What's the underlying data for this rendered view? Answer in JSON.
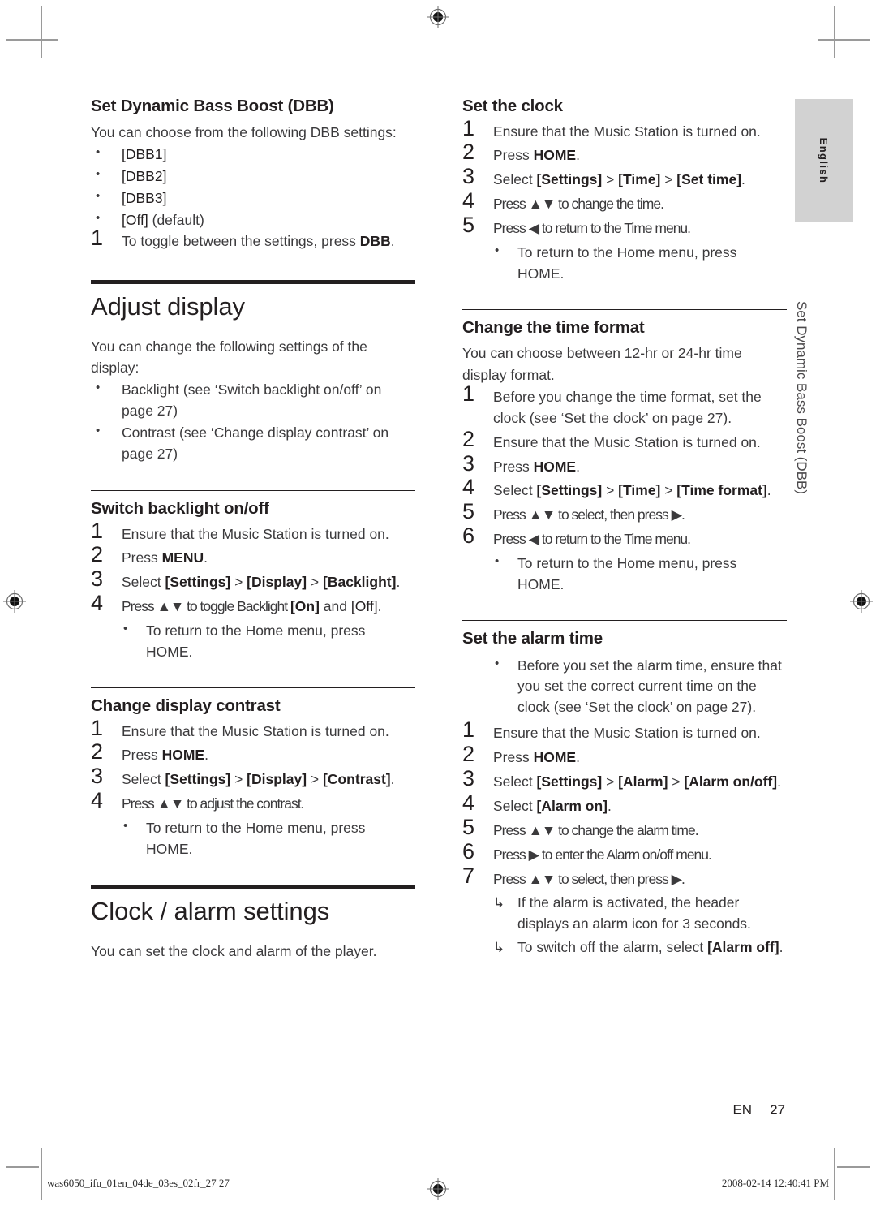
{
  "page": {
    "language_tab": "English",
    "running_head": "Set Dynamic Bass Boost (DBB)",
    "folio_lang": "EN",
    "folio_number": "27"
  },
  "print_footer": {
    "filename": "was6050_ifu_01en_04de_03es_02fr_27   27",
    "timestamp": "2008-02-14   12:40:41 PM"
  },
  "left_column": {
    "dbb": {
      "heading": "Set Dynamic Bass Boost (DBB)",
      "intro": "You can choose from the following DBB settings:",
      "options": [
        "[DBB1]",
        "[DBB2]",
        "[DBB3]"
      ],
      "option_default_key": "[Off]",
      "option_default_note": "(default)",
      "step_1_pre": "To toggle between the settings, press ",
      "step_1_key": "DBB",
      "step_1_post": "."
    },
    "adjust_display": {
      "chapter": "Adjust display",
      "intro": "You can change the following settings of the display:",
      "bullets": [
        "Backlight (see ‘Switch backlight on/off’ on page 27)",
        "Contrast (see ‘Change display contrast’ on page 27)"
      ]
    },
    "backlight": {
      "heading": "Switch backlight on/off",
      "step_1": "Ensure that the Music Station is turned on.",
      "step_2_pre": "Press ",
      "step_2_key": "MENU",
      "step_2_post": ".",
      "step_3_pre": "Select ",
      "step_3_k1": "[Settings]",
      "step_3_s1": " > ",
      "step_3_k2": "[Display]",
      "step_3_s2": " > ",
      "step_3_k3": "[Backlight]",
      "step_3_post": ".",
      "step_4_pre": "Press ▲▼ to toggle Backlight ",
      "step_4_k1": "[On]",
      "step_4_mid": " and ",
      "step_4_k2": "[Off]",
      "step_4_post": ".",
      "sub_bullet_line1": "To return to the Home menu, press",
      "sub_bullet_line2": "HOME."
    },
    "contrast": {
      "heading": "Change display contrast",
      "step_1": "Ensure that the Music Station is turned on.",
      "step_2_pre": "Press ",
      "step_2_key": "HOME",
      "step_2_post": ".",
      "step_3_pre": "Select ",
      "step_3_k1": "[Settings]",
      "step_3_s1": " > ",
      "step_3_k2": "[Display]",
      "step_3_s2": " > ",
      "step_3_k3": "[Contrast]",
      "step_3_post": ".",
      "step_4": "Press ▲▼ to adjust the contrast.",
      "sub_bullet_line1": "To return to the Home menu, press",
      "sub_bullet_line2": "HOME."
    },
    "clock_alarm": {
      "chapter": "Clock / alarm settings",
      "intro": "You can set the clock and alarm of the player."
    }
  },
  "right_column": {
    "set_clock": {
      "heading": "Set the clock",
      "step_1": "Ensure that the Music Station is turned on.",
      "step_2_pre": "Press ",
      "step_2_key": "HOME",
      "step_2_post": ".",
      "step_3_pre": "Select ",
      "step_3_k1": "[Settings]",
      "step_3_s1": " > ",
      "step_3_k2": "[Time]",
      "step_3_s2": " > ",
      "step_3_k3": "[Set time]",
      "step_3_post": ".",
      "step_4": "Press ▲▼ to change the time.",
      "step_5": "Press ◀ to return to the Time menu.",
      "sub_bullet_line1": "To return to the Home menu, press",
      "sub_bullet_line2": "HOME."
    },
    "time_format": {
      "heading": "Change the time format",
      "intro": "You can choose between 12-hr or 24-hr time display format.",
      "step_1": "Before you change the time format, set the clock (see ‘Set the clock’ on page 27).",
      "step_2": "Ensure that the Music Station is turned on.",
      "step_3_pre": "Press ",
      "step_3_key": "HOME",
      "step_3_post": ".",
      "step_4_pre": "Select ",
      "step_4_k1": "[Settings]",
      "step_4_s1": " > ",
      "step_4_k2": "[Time]",
      "step_4_s2": " > ",
      "step_4_k3": "[Time format]",
      "step_4_post": ".",
      "step_5": "Press ▲▼ to select, then press ▶.",
      "step_6": "Press ◀ to return to the Time menu.",
      "sub_bullet_line1": "To return to the Home menu, press",
      "sub_bullet_line2": "HOME."
    },
    "alarm_time": {
      "heading": "Set the alarm time",
      "lead_bullet": "Before you set the alarm time, ensure that you set the correct current time on the clock (see ‘Set the clock’ on page 27).",
      "step_1": "Ensure that the Music Station is turned on.",
      "step_2_pre": "Press ",
      "step_2_key": "HOME",
      "step_2_post": ".",
      "step_3_pre": "Select ",
      "step_3_k1": "[Settings]",
      "step_3_s1": " > ",
      "step_3_k2": "[Alarm]",
      "step_3_s2": " > ",
      "step_3_k3": "[Alarm on/off]",
      "step_3_post": ".",
      "step_4_pre": "Select ",
      "step_4_k1": "[Alarm on]",
      "step_4_post": ".",
      "step_5": "Press ▲▼ to change the alarm time.",
      "step_6": "Press ▶ to enter the Alarm on/off menu.",
      "step_7": "Press ▲▼ to select, then press ▶.",
      "result_1": "If the alarm is activated, the header displays an alarm icon for 3 seconds.",
      "result_2_pre": "To switch off the alarm, select ",
      "result_2_key": "[Alarm off]",
      "result_2_post": "."
    }
  }
}
